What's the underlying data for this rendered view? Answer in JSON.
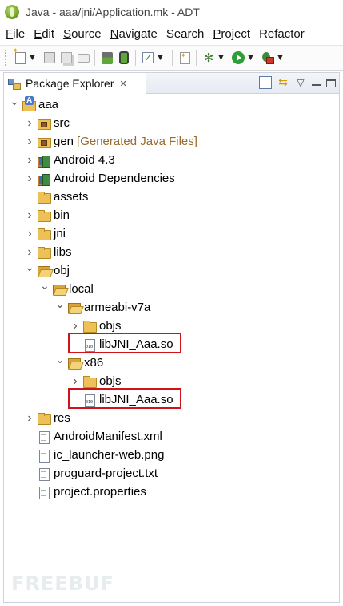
{
  "window": {
    "title": "Java - aaa/jni/Application.mk - ADT"
  },
  "menu": [
    {
      "key": "F",
      "rest": "ile"
    },
    {
      "key": "E",
      "rest": "dit"
    },
    {
      "key": "S",
      "rest": "ource"
    },
    {
      "key": "N",
      "rest": "avigate"
    },
    {
      "key": "S",
      "rest": "earch",
      "pre": "Se",
      "suf": "arch"
    },
    {
      "key": "P",
      "rest": "roject"
    },
    {
      "key": "R",
      "rest": "efactor"
    }
  ],
  "menu_labels": [
    "File",
    "Edit",
    "Source",
    "Navigate",
    "Search",
    "Project",
    "Refactor"
  ],
  "view": {
    "tab_label": "Package Explorer",
    "close_glyph": "✕"
  },
  "tree": [
    {
      "label": "aaa",
      "decor": "",
      "icon": "project-icon",
      "twisty": "expanded",
      "depth": 0
    },
    {
      "label": "src",
      "decor": "",
      "icon": "package-folder-icon",
      "twisty": "collapsed",
      "depth": 1
    },
    {
      "label": "gen",
      "decor": "[Generated Java Files]",
      "icon": "package-folder-icon",
      "twisty": "collapsed",
      "depth": 1
    },
    {
      "label": "Android 4.3",
      "decor": "",
      "icon": "library-icon",
      "twisty": "collapsed",
      "depth": 1
    },
    {
      "label": "Android Dependencies",
      "decor": "",
      "icon": "library-icon",
      "twisty": "collapsed",
      "depth": 1
    },
    {
      "label": "assets",
      "decor": "",
      "icon": "folder-icon",
      "twisty": "none",
      "depth": 1
    },
    {
      "label": "bin",
      "decor": "",
      "icon": "folder-icon",
      "twisty": "collapsed",
      "depth": 1
    },
    {
      "label": "jni",
      "decor": "",
      "icon": "folder-icon",
      "twisty": "collapsed",
      "depth": 1
    },
    {
      "label": "libs",
      "decor": "",
      "icon": "folder-icon",
      "twisty": "collapsed",
      "depth": 1
    },
    {
      "label": "obj",
      "decor": "",
      "icon": "open-folder-icon",
      "twisty": "expanded",
      "depth": 1
    },
    {
      "label": "local",
      "decor": "",
      "icon": "open-folder-icon",
      "twisty": "expanded",
      "depth": 2
    },
    {
      "label": "armeabi-v7a",
      "decor": "",
      "icon": "open-folder-icon",
      "twisty": "expanded",
      "depth": 3
    },
    {
      "label": "objs",
      "decor": "",
      "icon": "folder-icon",
      "twisty": "collapsed",
      "depth": 4
    },
    {
      "label": "libJNI_Aaa.so",
      "decor": "",
      "icon": "binary-file-icon",
      "twisty": "none",
      "depth": 4,
      "highlighted": true
    },
    {
      "label": "x86",
      "decor": "",
      "icon": "open-folder-icon",
      "twisty": "expanded",
      "depth": 3
    },
    {
      "label": "objs",
      "decor": "",
      "icon": "folder-icon",
      "twisty": "collapsed",
      "depth": 4
    },
    {
      "label": "libJNI_Aaa.so",
      "decor": "",
      "icon": "binary-file-icon",
      "twisty": "none",
      "depth": 4,
      "highlighted": true
    },
    {
      "label": "res",
      "decor": "",
      "icon": "folder-icon",
      "twisty": "collapsed",
      "depth": 1
    },
    {
      "label": "AndroidManifest.xml",
      "decor": "",
      "icon": "file-icon",
      "twisty": "none",
      "depth": 1
    },
    {
      "label": "ic_launcher-web.png",
      "decor": "",
      "icon": "file-icon",
      "twisty": "none",
      "depth": 1
    },
    {
      "label": "proguard-project.txt",
      "decor": "",
      "icon": "file-icon",
      "twisty": "none",
      "depth": 1
    },
    {
      "label": "project.properties",
      "decor": "",
      "icon": "file-icon",
      "twisty": "none",
      "depth": 1
    }
  ],
  "watermark": "FREEBUF",
  "colors": {
    "highlight_border": "#d0121b",
    "decoration_text": "#9a6a2a",
    "view_border": "#cdd3dc"
  }
}
